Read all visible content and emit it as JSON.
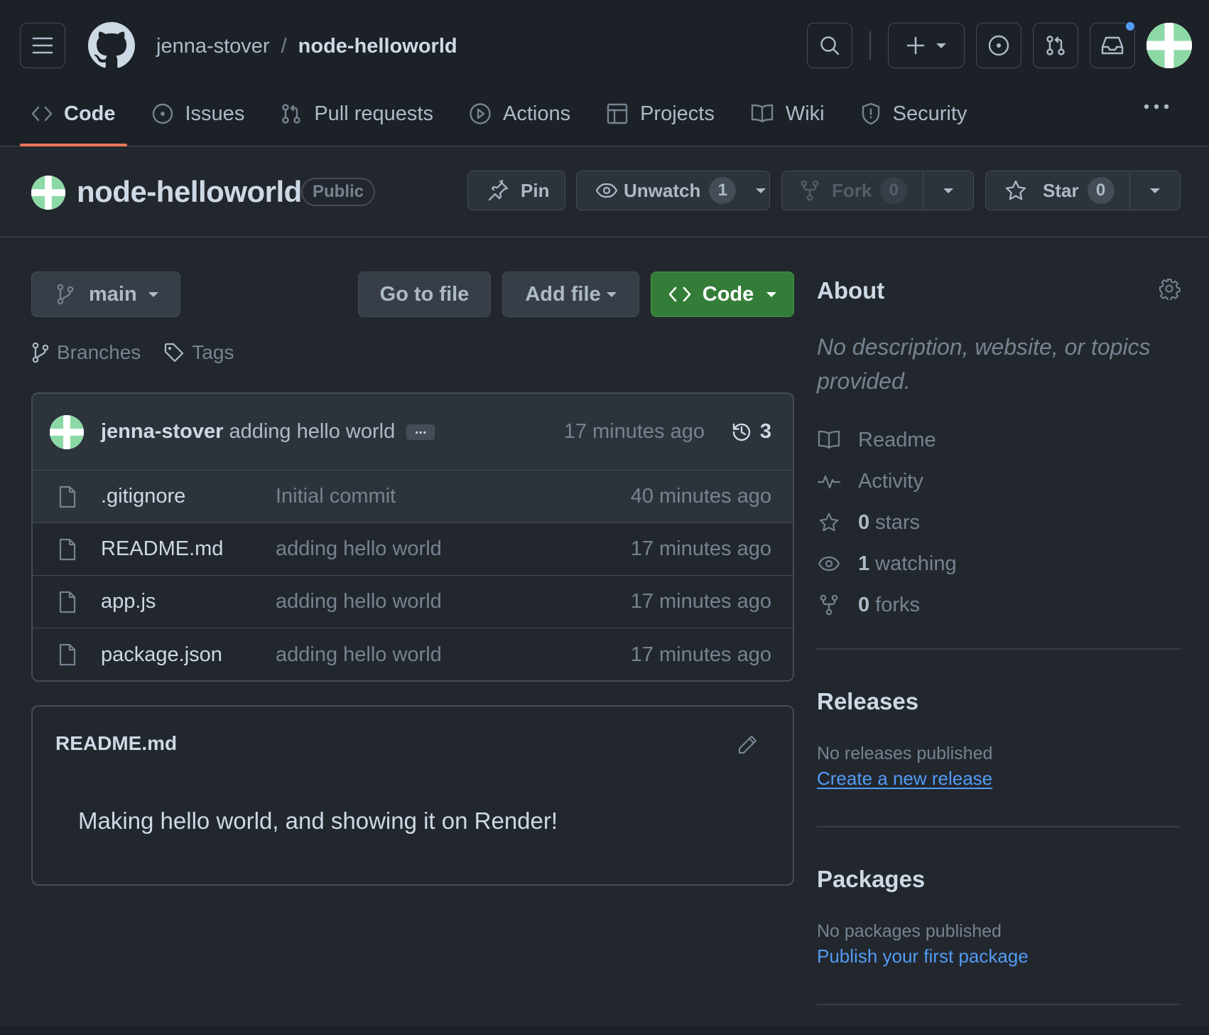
{
  "header": {
    "owner": "jenna-stover",
    "separator": "/",
    "repo": "node-helloworld"
  },
  "tabs": [
    {
      "label": "Code",
      "icon": "code-icon",
      "active": true
    },
    {
      "label": "Issues",
      "icon": "issue-icon"
    },
    {
      "label": "Pull requests",
      "icon": "pull-request-icon"
    },
    {
      "label": "Actions",
      "icon": "play-icon"
    },
    {
      "label": "Projects",
      "icon": "table-icon"
    },
    {
      "label": "Wiki",
      "icon": "book-icon"
    },
    {
      "label": "Security",
      "icon": "shield-icon"
    }
  ],
  "repo_head": {
    "name": "node-helloworld",
    "visibility": "Public",
    "pin_label": "Pin",
    "watch_label": "Unwatch",
    "watch_count": "1",
    "fork_label": "Fork",
    "fork_count": "0",
    "star_label": "Star",
    "star_count": "0"
  },
  "toolbar": {
    "branch": "main",
    "go_to_file": "Go to file",
    "add_file": "Add file",
    "code": "Code",
    "branches": "Branches",
    "tags": "Tags"
  },
  "latest_commit": {
    "author": "jenna-stover",
    "message": "adding hello world",
    "ellipsis": "...",
    "time": "17 minutes ago",
    "commit_count": "3"
  },
  "files": [
    {
      "name": ".gitignore",
      "message": "Initial commit",
      "time": "40 minutes ago"
    },
    {
      "name": "README.md",
      "message": "adding hello world",
      "time": "17 minutes ago"
    },
    {
      "name": "app.js",
      "message": "adding hello world",
      "time": "17 minutes ago"
    },
    {
      "name": "package.json",
      "message": "adding hello world",
      "time": "17 minutes ago"
    }
  ],
  "readme": {
    "title": "README.md",
    "body": "Making hello world, and showing it on Render!"
  },
  "about": {
    "title": "About",
    "description": "No description, website, or topics provided.",
    "readme": "Readme",
    "activity": "Activity",
    "stars_count": "0",
    "stars_label": "stars",
    "watching_count": "1",
    "watching_label": "watching",
    "forks_count": "0",
    "forks_label": "forks"
  },
  "releases": {
    "title": "Releases",
    "empty": "No releases published",
    "link": "Create a new release"
  },
  "packages": {
    "title": "Packages",
    "empty": "No packages published",
    "link": "Publish your first package"
  },
  "colors": {
    "background": "#22272e",
    "header": "#1c2128",
    "accent_tab": "#ec775c",
    "green_button": "#347d39",
    "link": "#539bf5",
    "notification_dot": "#539bf5"
  }
}
